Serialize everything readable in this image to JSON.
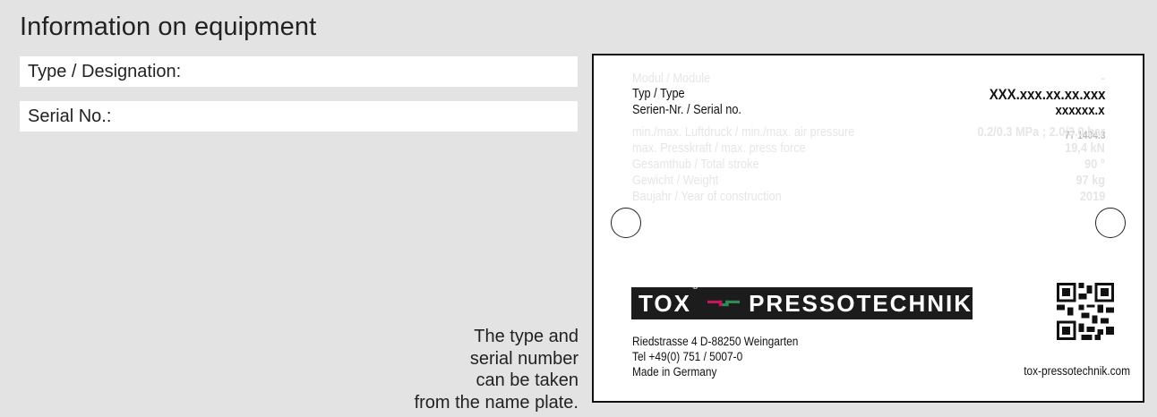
{
  "heading": "Information on equipment",
  "fields": {
    "type_label": "Type / Designation:",
    "serial_label": "Serial No.:"
  },
  "hint": {
    "line1": "The type and",
    "line2": "serial number",
    "line3": "can be taken",
    "line4": "from the name plate."
  },
  "nameplate": {
    "rows": [
      {
        "label": "Modul / Module",
        "value": "-"
      },
      {
        "label": "Typ / Type",
        "value": "XXX.xxx.xx.xx.xxx"
      },
      {
        "label": "Serien-Nr. / Serial no.",
        "value": "xxxxxx.x"
      },
      {
        "label": "min./max. Luftdruck / min./max. air pressure",
        "value": "0.2/0.3 MPa ; 2.0/3.0 bar"
      },
      {
        "label": "max. Presskraft / max. press force",
        "value": "19,4 kN"
      },
      {
        "label": "Gesamthub / Total stroke",
        "value": "90 °"
      },
      {
        "label": "Gewicht / Weight",
        "value": "97 kg"
      },
      {
        "label": "Baujahr / Year of construction",
        "value": "2019"
      }
    ],
    "ghost_serial": "77 1404.3",
    "logo": {
      "left": "TOX",
      "reg": "®",
      "right": "PRESSOTECHNIK"
    },
    "address": {
      "street": "Riedstrasse 4 D-88250 Weingarten",
      "tel": "Tel +49(0) 751 / 5007-0",
      "made": "Made in Germany"
    },
    "url": "tox-pressotechnik.com"
  },
  "colors": {
    "background": "#e3e3e3",
    "logo_bar": "#1c1c1c",
    "logo_magenta": "#c2185b",
    "logo_green": "#2e8b57"
  }
}
